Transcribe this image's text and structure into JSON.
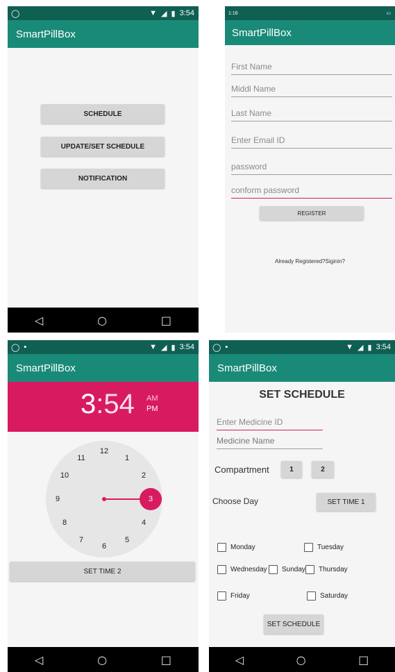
{
  "colors": {
    "primary": "#1a8a78",
    "primary_dark": "#0f5f52",
    "accent": "#d81b60",
    "navbar": "#000000"
  },
  "home": {
    "status": {
      "time": "3:54",
      "icons": [
        "whatsapp-icon",
        "wifi-icon",
        "signal-icon",
        "battery-icon"
      ]
    },
    "app_title": "SmartPillBox",
    "buttons": [
      "SCHEDULE",
      "UPDATE/SET SCHEDULE",
      "NOTIFICATION"
    ]
  },
  "register": {
    "status": {
      "left_text": "1:16",
      "right_text": ""
    },
    "app_title": "SmartPillBox",
    "fields": {
      "first_name": "First Name",
      "middle_name": "Middl Name",
      "last_name": "Last Name",
      "email": "Enter Email ID",
      "password": "password",
      "confirm_password": "conform password"
    },
    "register_label": "REGISTER",
    "signin_link": "Already Registered?Siginin?"
  },
  "time_picker": {
    "status": {
      "time": "3:54"
    },
    "app_title": "SmartPillBox",
    "time_display": {
      "hour": "3",
      "separator": ":",
      "minutes": "54",
      "am": "AM",
      "pm": "PM"
    },
    "dial_numbers": [
      "12",
      "1",
      "2",
      "3",
      "4",
      "5",
      "6",
      "7",
      "8",
      "9",
      "10",
      "11"
    ],
    "selected_hour": "3",
    "set_time_label": "SET TIME 2"
  },
  "schedule": {
    "status": {
      "time": "3:54"
    },
    "app_title": "SmartPillBox",
    "heading": "SET SCHEDULE",
    "medicine_id_placeholder": "Enter Medicine ID",
    "medicine_name_placeholder": "Medicine Name",
    "compartment_label": "Compartment",
    "compartment_buttons": [
      "1",
      "2"
    ],
    "choose_day_label": "Choose Day",
    "set_time_label": "SET TIME 1",
    "days": [
      "Monday",
      "Tuesday",
      "Wednesday",
      "Sunday",
      "Thursday",
      "Friday",
      "Saturday"
    ],
    "set_schedule_label": "SET SCHEDULE"
  },
  "nav": {
    "back": "◁",
    "home": "○",
    "recent": "□"
  }
}
